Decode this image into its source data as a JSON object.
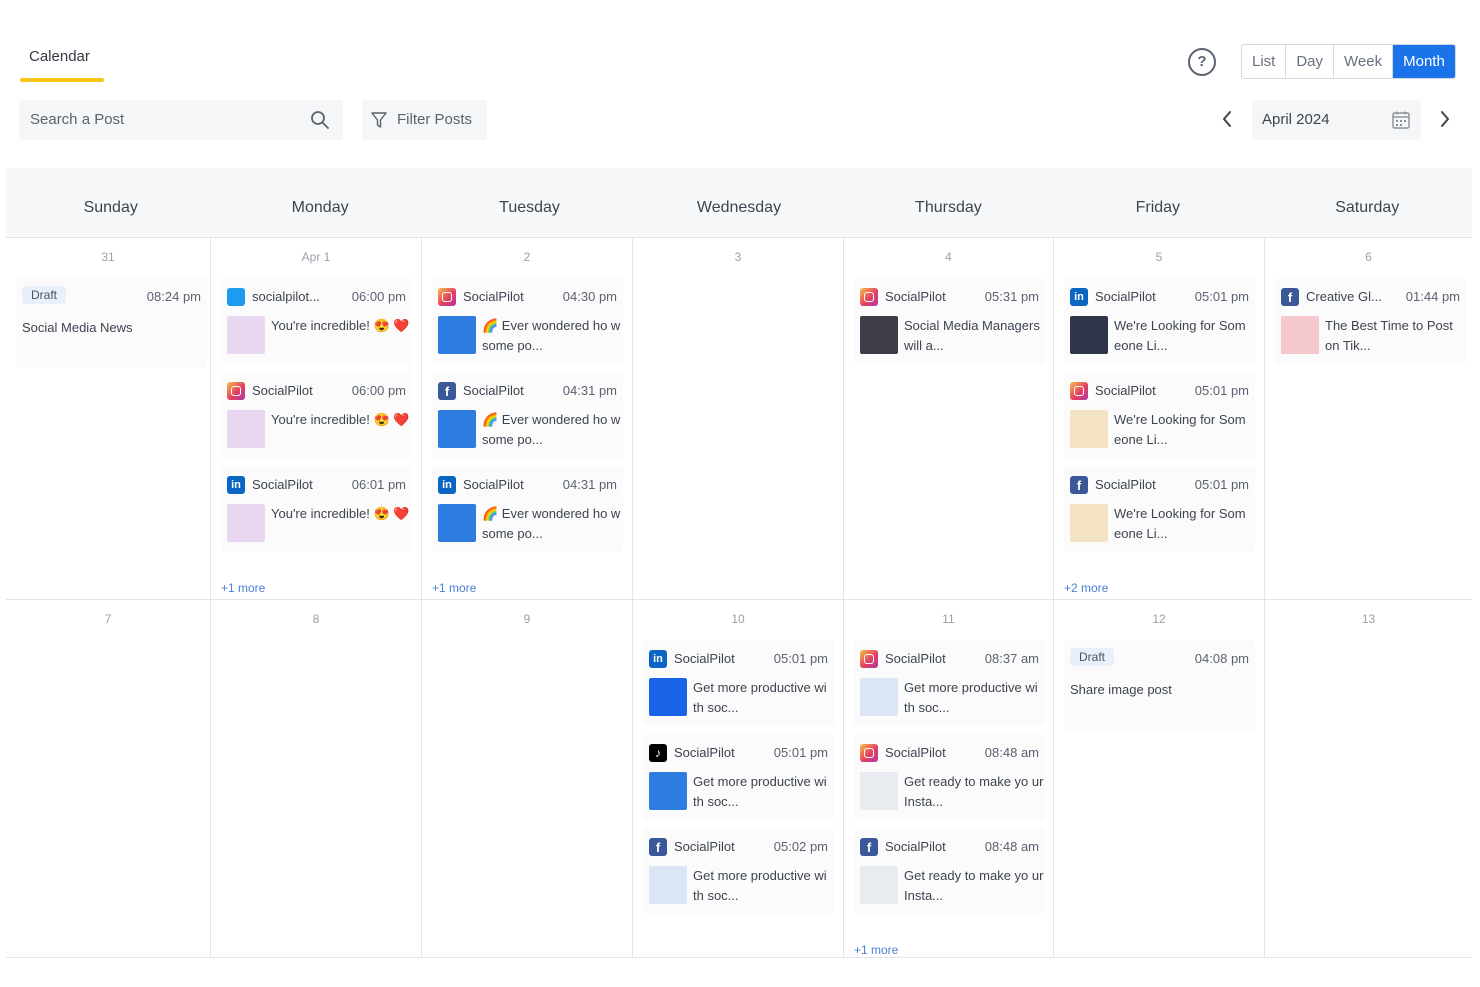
{
  "toolbar": {
    "tab_label": "Calendar",
    "search_placeholder": "Search a Post",
    "filter_label": "Filter Posts",
    "help_label": "?",
    "views": [
      "List",
      "Day",
      "Week",
      "Month"
    ],
    "active_view": "Month",
    "current_month": "April 2024"
  },
  "accent_color": "#1a73e8",
  "tab_underline_color": "#f5c518",
  "weekdays": [
    "Sunday",
    "Monday",
    "Tuesday",
    "Wednesday",
    "Thursday",
    "Friday",
    "Saturday"
  ],
  "weeks": [
    {
      "days": [
        {
          "num": "31",
          "posts": [
            {
              "draft": true,
              "label": "Draft",
              "time": "08:24 pm",
              "text": "Social Media News"
            }
          ],
          "more": ""
        },
        {
          "num": "Apr 1",
          "posts": [
            {
              "network": "twitter",
              "name": "socialpilot...",
              "time": "06:00 pm",
              "text": "You're incredible! 😍 ❤️",
              "thumb": "pink"
            },
            {
              "network": "instagram",
              "name": "SocialPilot",
              "time": "06:00 pm",
              "text": "You're incredible! 😍 ❤️",
              "thumb": "pink"
            },
            {
              "network": "linkedin",
              "name": "SocialPilot",
              "time": "06:01 pm",
              "text": "You're incredible! 😍 ❤️",
              "thumb": "pink"
            }
          ],
          "more": "+1 more"
        },
        {
          "num": "2",
          "posts": [
            {
              "network": "instagram",
              "name": "SocialPilot",
              "time": "04:30 pm",
              "text": "🌈 Ever wondered ho w some po...",
              "thumb": "blue"
            },
            {
              "network": "facebook",
              "name": "SocialPilot",
              "time": "04:31 pm",
              "text": "🌈 Ever wondered ho w some po...",
              "thumb": "blue"
            },
            {
              "network": "linkedin",
              "name": "SocialPilot",
              "time": "04:31 pm",
              "text": "🌈 Ever wondered ho w some po...",
              "thumb": "blue"
            }
          ],
          "more": "+1 more"
        },
        {
          "num": "3",
          "posts": [],
          "more": ""
        },
        {
          "num": "4",
          "posts": [
            {
              "network": "instagram",
              "name": "SocialPilot",
              "time": "05:31 pm",
              "text": "Social Media Managers will a...",
              "thumb": "dark"
            }
          ],
          "more": ""
        },
        {
          "num": "5",
          "posts": [
            {
              "network": "linkedin",
              "name": "SocialPilot",
              "time": "05:01 pm",
              "text": "We're Looking for Som eone Li...",
              "thumb": "book"
            },
            {
              "network": "instagram",
              "name": "SocialPilot",
              "time": "05:01 pm",
              "text": "We're Looking for Som eone Li...",
              "thumb": "cream"
            },
            {
              "network": "facebook",
              "name": "SocialPilot",
              "time": "05:01 pm",
              "text": "We're Looking for Som eone Li...",
              "thumb": "cream"
            }
          ],
          "more": "+2 more"
        },
        {
          "num": "6",
          "posts": [
            {
              "network": "facebook",
              "name": "Creative Gl...",
              "time": "01:44 pm",
              "text": "The Best Time to Post on Tik...",
              "thumb": "coral"
            }
          ],
          "more": ""
        }
      ]
    },
    {
      "days": [
        {
          "num": "7",
          "posts": [],
          "more": ""
        },
        {
          "num": "8",
          "posts": [],
          "more": ""
        },
        {
          "num": "9",
          "posts": [],
          "more": ""
        },
        {
          "num": "10",
          "posts": [
            {
              "network": "linkedin",
              "name": "SocialPilot",
              "time": "05:01 pm",
              "text": "Get more productive wi th soc...",
              "thumb": "solid"
            },
            {
              "network": "tiktok",
              "name": "SocialPilot",
              "time": "05:01 pm",
              "text": "Get more productive wi th soc...",
              "thumb": "blue"
            },
            {
              "network": "facebook",
              "name": "SocialPilot",
              "time": "05:02 pm",
              "text": "Get more productive wi th soc...",
              "thumb": "light"
            }
          ],
          "more": ""
        },
        {
          "num": "11",
          "posts": [
            {
              "network": "instagram",
              "name": "SocialPilot",
              "time": "08:37 am",
              "text": "Get more productive wi th soc...",
              "thumb": "light"
            },
            {
              "network": "instagram",
              "name": "SocialPilot",
              "time": "08:48 am",
              "text": "Get ready to make yo ur Insta...",
              "thumb": "gray"
            },
            {
              "network": "facebook",
              "name": "SocialPilot",
              "time": "08:48 am",
              "text": "Get ready to make yo ur Insta...",
              "thumb": "gray"
            }
          ],
          "more": "+1 more"
        },
        {
          "num": "12",
          "posts": [
            {
              "draft": true,
              "label": "Draft",
              "time": "04:08 pm",
              "text": "Share image post"
            }
          ],
          "more": ""
        },
        {
          "num": "13",
          "posts": [],
          "more": ""
        }
      ]
    }
  ]
}
